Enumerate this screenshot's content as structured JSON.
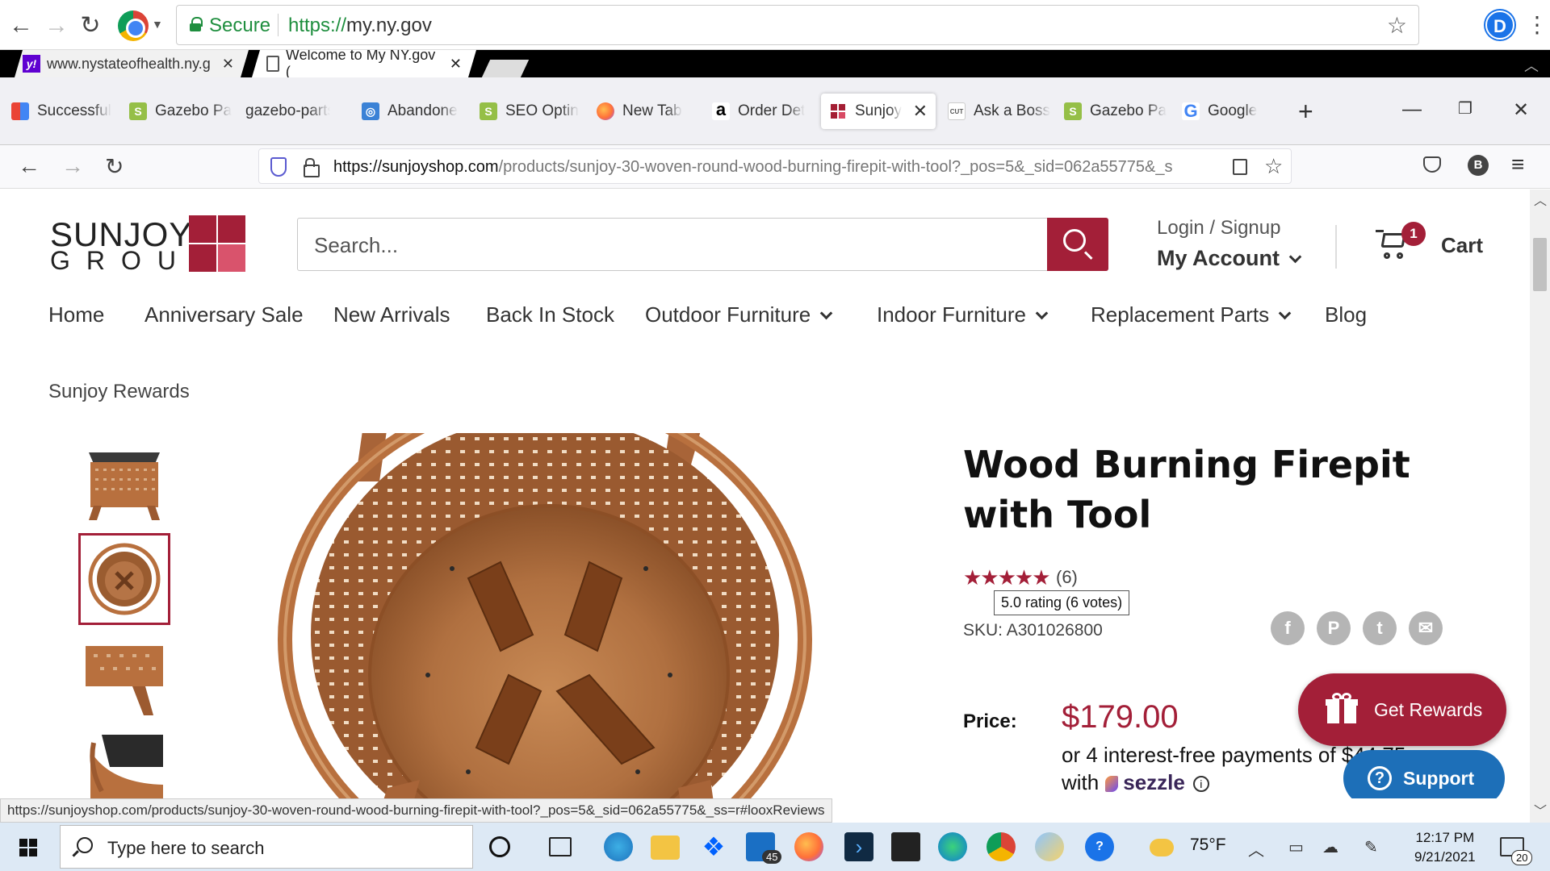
{
  "chrome": {
    "secure_label": "Secure",
    "url_scheme": "https://",
    "url_host": "my.ny.gov",
    "profile_initial": "D"
  },
  "outer_tabs": [
    {
      "label": "www.nystateofhealth.ny.g"
    },
    {
      "label": "Welcome to My NY.gov ("
    }
  ],
  "firefox_tabs": [
    {
      "label": "Successful",
      "icon": "shopping-bag-icon"
    },
    {
      "label": "Gazebo Pa",
      "icon": "shopify-icon"
    },
    {
      "label": "gazebo-parts-",
      "icon": "none"
    },
    {
      "label": "Abandone",
      "icon": "app-icon"
    },
    {
      "label": "SEO Optin",
      "icon": "shopify-icon"
    },
    {
      "label": "New Tab",
      "icon": "firefox-icon"
    },
    {
      "label": "Order Det",
      "icon": "amazon-icon"
    },
    {
      "label": "Sunjoy",
      "icon": "sunjoy-icon",
      "active": true
    },
    {
      "label": "Ask a Boss",
      "icon": "cut-icon"
    },
    {
      "label": "Gazebo Pa",
      "icon": "shopify-icon"
    },
    {
      "label": "Google",
      "icon": "google-icon"
    }
  ],
  "firefox_url": {
    "host": "https://sunjoyshop.com",
    "path": "/products/sunjoy-30-woven-round-wood-burning-firepit-with-tool?_pos=5&_sid=062a55775&_s",
    "profile_initial": "B"
  },
  "site": {
    "logo_line1": "SUNJOY",
    "logo_line2": "GROUP",
    "search_placeholder": "Search...",
    "login_label": "Login / Signup",
    "account_label": "My Account",
    "cart_count": "1",
    "cart_label": "Cart",
    "nav": [
      "Home",
      "Anniversary Sale",
      "New Arrivals",
      "Back In Stock",
      "Outdoor Furniture",
      "Indoor Furniture",
      "Replacement Parts",
      "Blog"
    ],
    "rewards_link": "Sunjoy Rewards",
    "brand_color": "#a31f38"
  },
  "product": {
    "title": "Wood Burning Firepit with Tool",
    "stars": "★★★★★",
    "review_count": "(6)",
    "rating_tooltip": "5.0 rating (6 votes)",
    "sku": "SKU: A301026800",
    "price_label": "Price:",
    "price": "$179.00",
    "installments": "or 4 interest-free payments of $44.75",
    "installments_with": "with",
    "sezzle": "sezzle",
    "share_icons": [
      "facebook-icon",
      "pinterest-icon",
      "twitter-icon",
      "email-icon"
    ]
  },
  "widgets": {
    "rewards_button": "Get Rewards",
    "support_button": "Support"
  },
  "status_bar_url": "https://sunjoyshop.com/products/sunjoy-30-woven-round-wood-burning-firepit-with-tool?_pos=5&_sid=062a55775&_ss=r#looxReviews",
  "taskbar": {
    "search_placeholder": "Type here to search",
    "mail_badge": "45",
    "temperature": "75°F",
    "time": "12:17 PM",
    "date": "9/21/2021",
    "notification_count": "20"
  }
}
